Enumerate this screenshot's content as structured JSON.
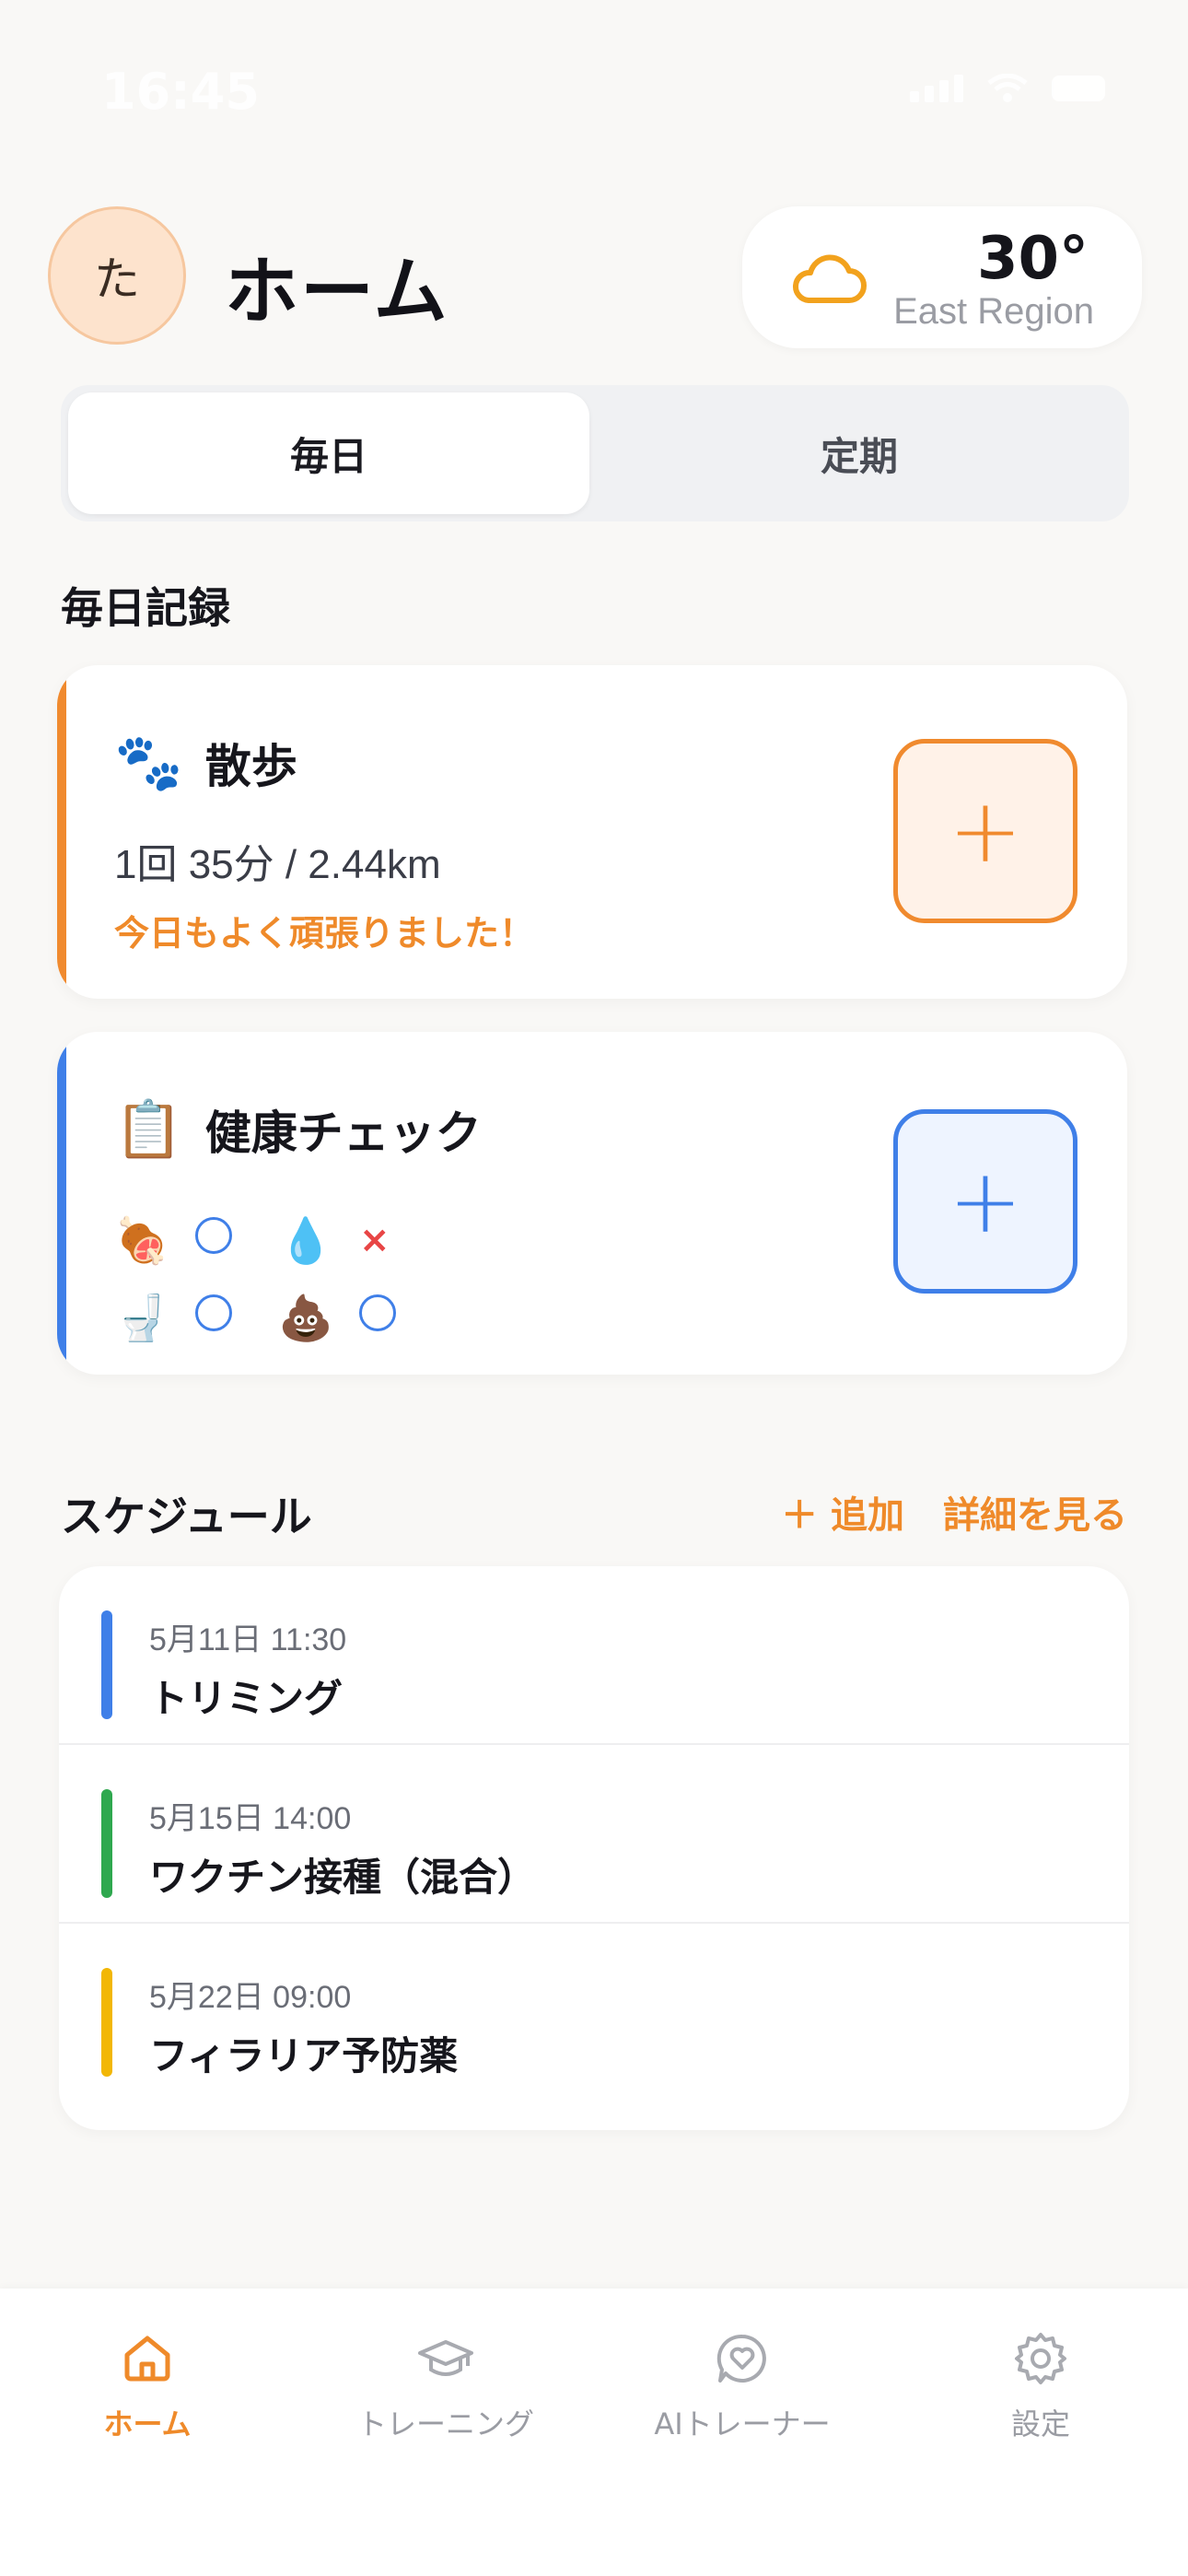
{
  "status_bar": {
    "time": "16:45"
  },
  "header": {
    "avatar_initial": "た",
    "title": "ホーム",
    "weather": {
      "icon": "cloud-icon",
      "temperature": "30°",
      "region": "East Region"
    }
  },
  "segment": {
    "daily": "毎日",
    "periodic": "定期"
  },
  "daily_section": {
    "title": "毎日記録",
    "walk": {
      "icon": "🐾",
      "title": "散歩",
      "stats": "1回 35分 / 2.44km",
      "message": "今日もよく頑張りました！",
      "add": "+"
    },
    "health": {
      "icon": "📋",
      "title": "健康チェック",
      "add": "+",
      "items": [
        {
          "icon": "🍖",
          "status": "○"
        },
        {
          "icon": "💧",
          "status": "×"
        },
        {
          "icon": "🚽",
          "status": "○"
        },
        {
          "icon": "💩",
          "status": "○"
        }
      ]
    }
  },
  "schedule": {
    "title": "スケジュール",
    "add_label": "＋ 追加",
    "details_label": "詳細を見る",
    "items": [
      {
        "date": "5月11日 11:30",
        "title": "トリミング",
        "color": "#3f7fe8"
      },
      {
        "date": "5月15日 14:00",
        "title": "ワクチン接種（混合）",
        "color": "#2fa84f"
      },
      {
        "date": "5月22日 09:00",
        "title": "フィラリア予防薬",
        "color": "#f2b705"
      }
    ]
  },
  "nav": {
    "home": "ホーム",
    "training": "トレーニング",
    "ai_trainer": "AIトレーナー",
    "settings": "設定"
  },
  "colors": {
    "accent": "#ef8a2a",
    "blue": "#3f7fe8"
  }
}
